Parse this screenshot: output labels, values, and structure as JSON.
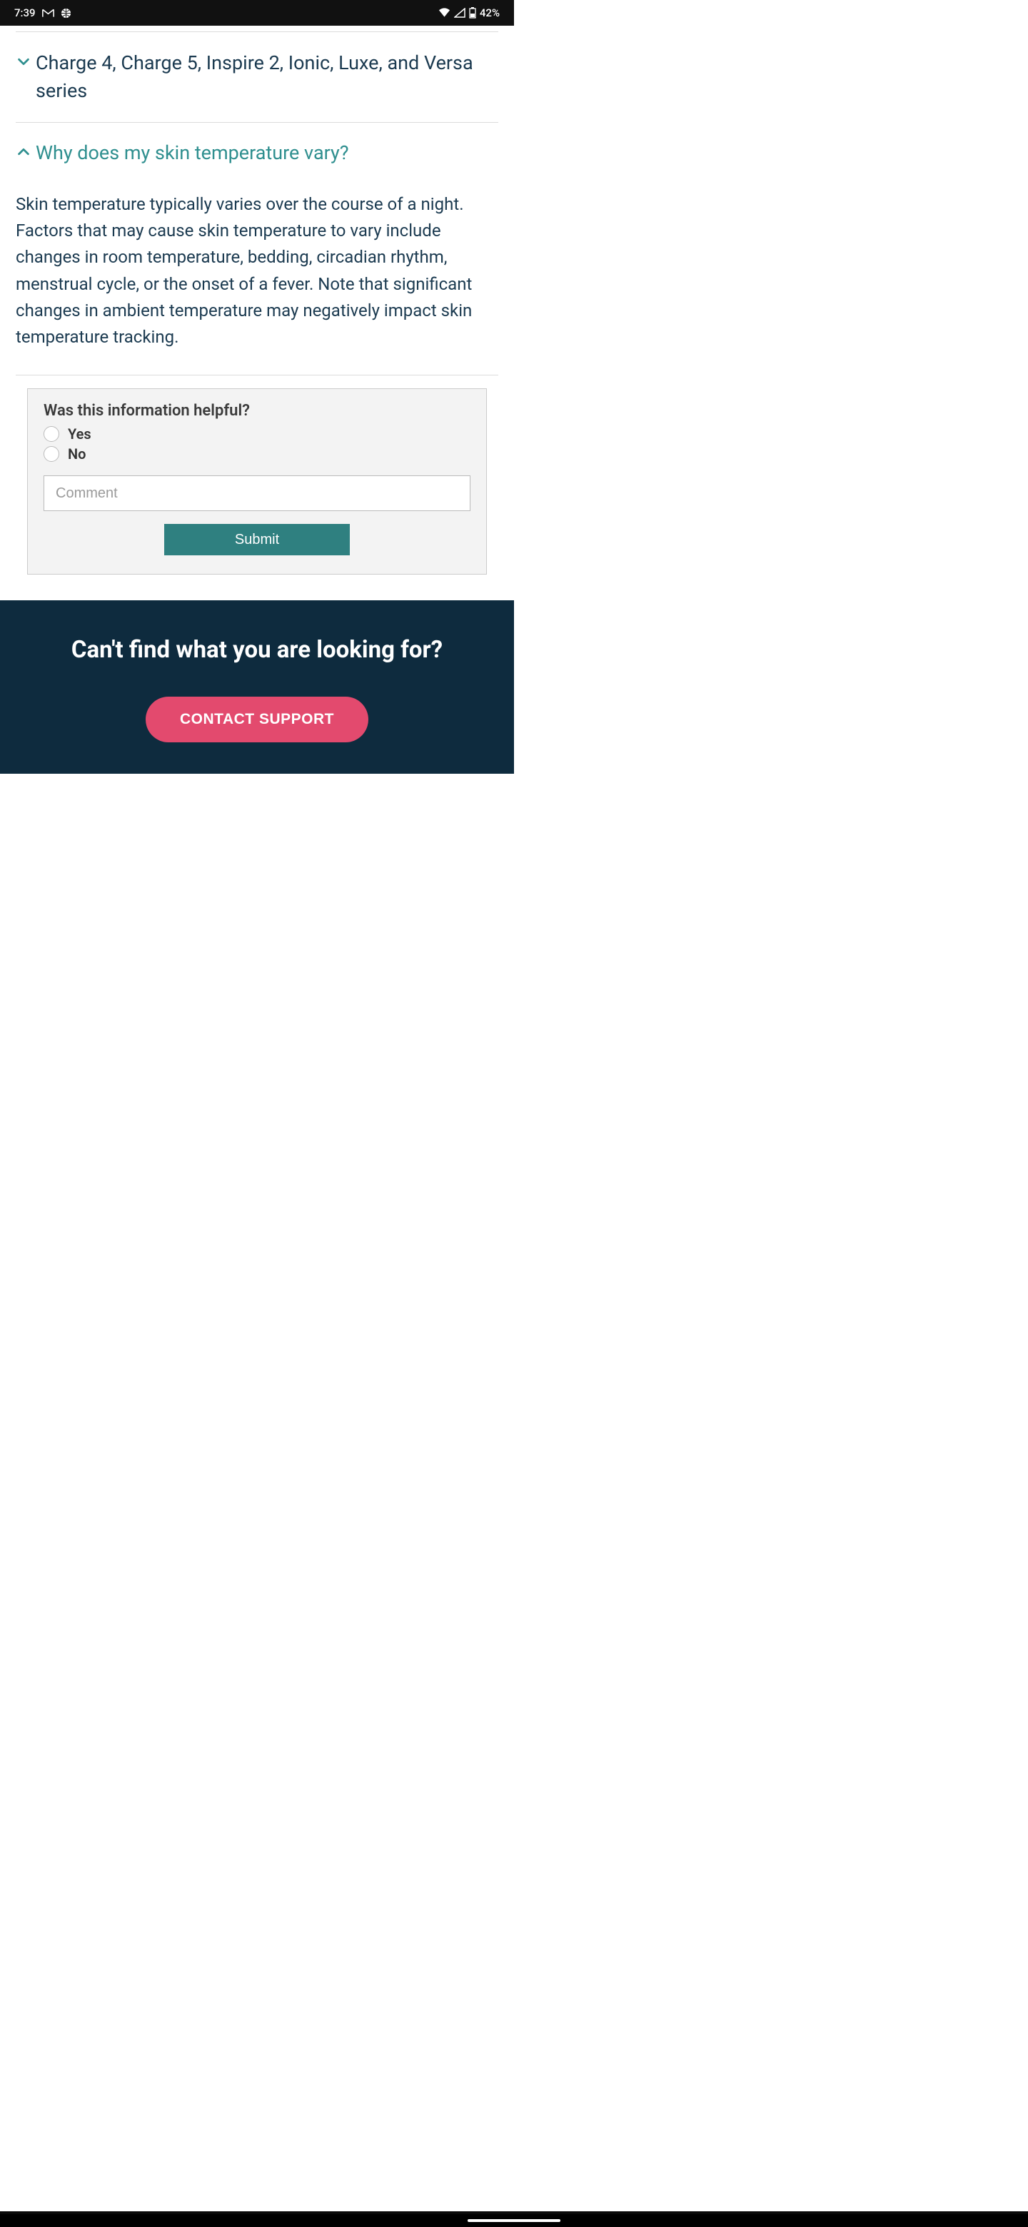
{
  "status": {
    "time": "7:39",
    "battery": "42%"
  },
  "accordion": {
    "collapsed": {
      "title": "Charge 4, Charge 5, Inspire 2, Ionic, Luxe, and Versa series"
    },
    "expanded": {
      "title": "Why does my skin temperature vary?",
      "body": "Skin temperature typically varies over the course of a night. Factors that may cause skin temperature to vary include changes in room temperature, bedding, circadian rhythm, menstrual cycle, or the onset of a fever. Note that significant changes in ambient temperature may negatively impact skin temperature tracking."
    }
  },
  "feedback": {
    "title": "Was this information helpful?",
    "yes": "Yes",
    "no": "No",
    "comment_placeholder": "Comment",
    "submit": "Submit"
  },
  "footer": {
    "title": "Can't find what you are looking for?",
    "button": "CONTACT SUPPORT"
  }
}
